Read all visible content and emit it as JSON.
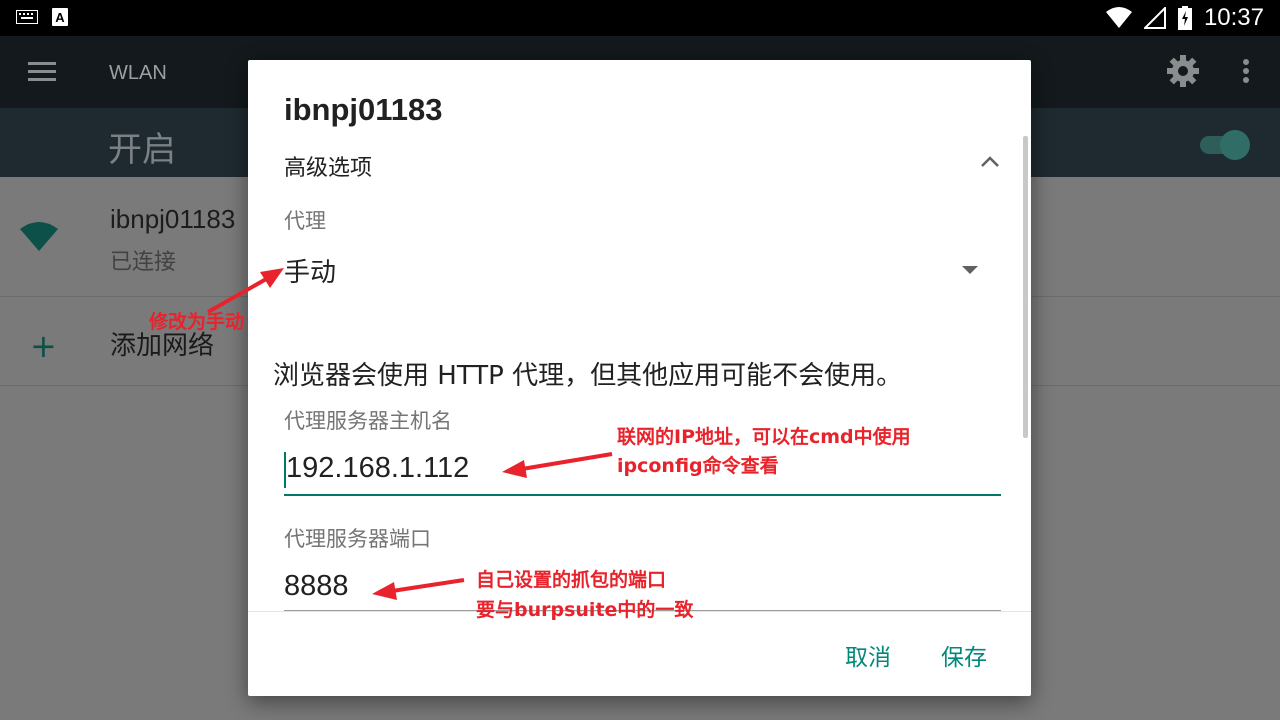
{
  "status_bar": {
    "time": "10:37",
    "icons": [
      "keyboard-icon",
      "a-badge-icon",
      "wifi-icon",
      "signal-icon",
      "battery-icon"
    ]
  },
  "toolbar": {
    "title": "WLAN"
  },
  "switch_bar": {
    "label": "开启",
    "on": true
  },
  "networks": [
    {
      "ssid": "ibnpj01183",
      "status": "已连接"
    }
  ],
  "add_network": {
    "label": "添加网络"
  },
  "dialog": {
    "title": "ibnpj01183",
    "advanced_label": "高级选项",
    "proxy_label": "代理",
    "proxy_value": "手动",
    "warning": "浏览器会使用 HTTP 代理，但其他应用可能不会使用。",
    "host_label": "代理服务器主机名",
    "host_value": "192.168.1.112",
    "port_label": "代理服务器端口",
    "port_value": "8888",
    "cancel": "取消",
    "save": "保存"
  },
  "annotations": {
    "manual": "修改为手动",
    "ip_line1": "联网的IP地址，可以在cmd中使用",
    "ip_line2": "ipconfig命令查看",
    "port_line1": "自己设置的抓包的端口",
    "port_line2": "要与burpsuite中的一致"
  },
  "colors": {
    "accent": "#00897b",
    "annotation": "#e8232b",
    "status_bar": "#000000",
    "toolbar": "#13191c"
  }
}
